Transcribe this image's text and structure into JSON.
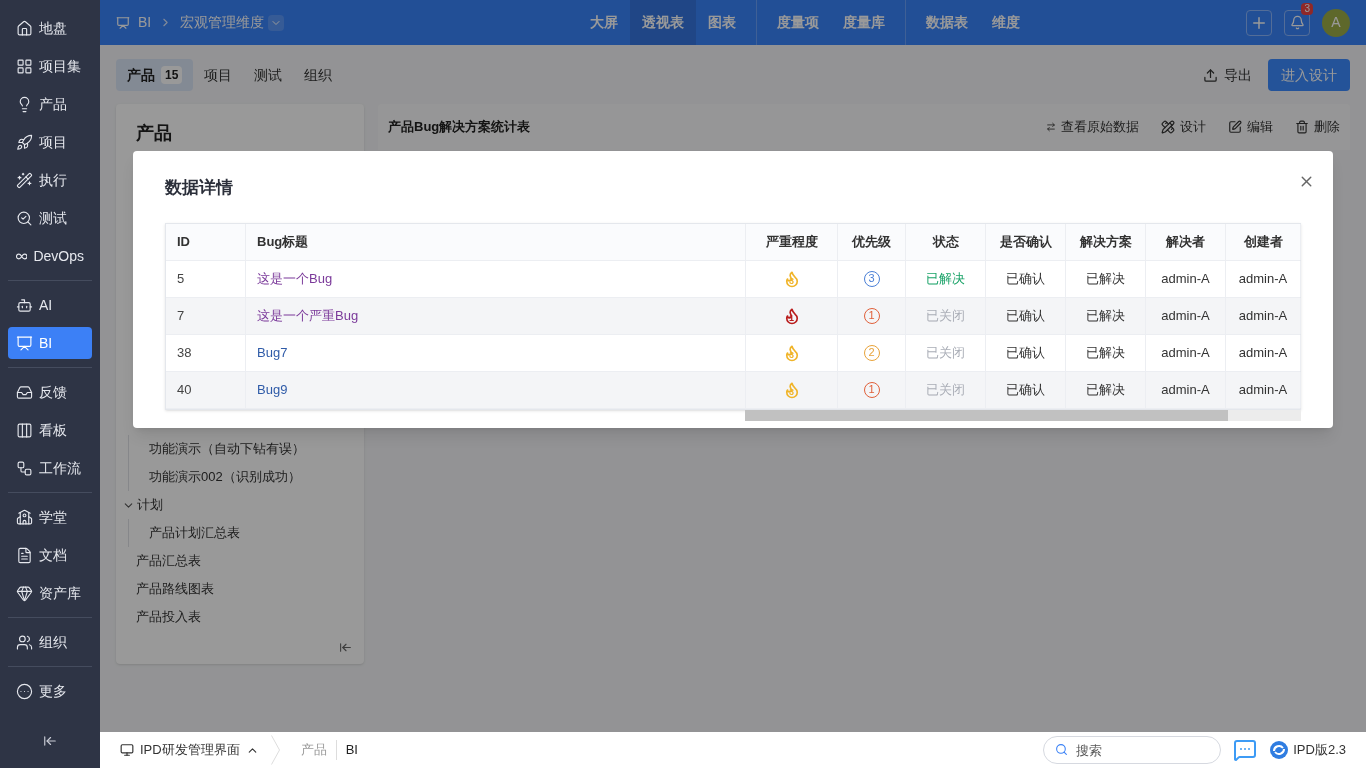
{
  "sidebar": {
    "groups": [
      [
        {
          "label": "地盘",
          "selected": false
        },
        {
          "label": "项目集",
          "selected": false
        },
        {
          "label": "产品",
          "selected": false
        },
        {
          "label": "项目",
          "selected": false
        },
        {
          "label": "执行",
          "selected": false
        },
        {
          "label": "测试",
          "selected": false
        },
        {
          "label": "DevOps",
          "selected": false
        }
      ],
      [
        {
          "label": "AI",
          "selected": false
        },
        {
          "label": "BI",
          "selected": true
        }
      ],
      [
        {
          "label": "反馈",
          "selected": false
        },
        {
          "label": "看板",
          "selected": false
        },
        {
          "label": "工作流",
          "selected": false
        }
      ],
      [
        {
          "label": "学堂",
          "selected": false
        },
        {
          "label": "文档",
          "selected": false
        },
        {
          "label": "资产库",
          "selected": false
        }
      ],
      [
        {
          "label": "组织",
          "selected": false
        }
      ],
      [
        {
          "label": "更多",
          "selected": false
        }
      ]
    ]
  },
  "topbar": {
    "breadcrumb": [
      "BI",
      "宏观管理维度"
    ],
    "nav_groups": [
      [
        {
          "label": "大屏",
          "selected": false
        },
        {
          "label": "透视表",
          "selected": true
        },
        {
          "label": "图表",
          "selected": false
        }
      ],
      [
        {
          "label": "度量项",
          "selected": false
        },
        {
          "label": "度量库",
          "selected": false
        }
      ],
      [
        {
          "label": "数据表",
          "selected": false
        },
        {
          "label": "维度",
          "selected": false
        }
      ]
    ],
    "notification_count": "3",
    "avatar": "A"
  },
  "subtabs": [
    {
      "label": "产品",
      "count": "15",
      "selected": true
    },
    {
      "label": "项目",
      "selected": false
    },
    {
      "label": "测试",
      "selected": false
    },
    {
      "label": "组织",
      "selected": false
    }
  ],
  "actions": {
    "export": "导出",
    "design": "进入设计"
  },
  "left_panel": {
    "title": "产品",
    "tree": [
      {
        "expanded": true,
        "children": [
          {
            "label": "功能演示（自动下钻有误）"
          },
          {
            "label": "功能演示002（识别成功）"
          }
        ]
      },
      {
        "label": "计划",
        "expanded": true,
        "children": [
          {
            "label": "产品计划汇总表"
          }
        ]
      },
      {
        "label": "产品汇总表"
      },
      {
        "label": "产品路线图表"
      },
      {
        "label": "产品投入表"
      }
    ]
  },
  "report": {
    "title": "产品Bug解决方案统计表",
    "actions": [
      "查看原始数据",
      "设计",
      "编辑",
      "删除"
    ]
  },
  "modal": {
    "title": "数据详情",
    "columns": [
      "ID",
      "Bug标题",
      "严重程度",
      "优先级",
      "状态",
      "是否确认",
      "解决方案",
      "解决者",
      "创建者"
    ],
    "rows": [
      {
        "id": "5",
        "title": "这是一个Bug",
        "visited": true,
        "severity": {
          "value": "3",
          "color": "#f0b429"
        },
        "priority": {
          "value": "3",
          "color": "#4a7fd6"
        },
        "status": {
          "text": "已解决",
          "closed": false
        },
        "confirmed": "已确认",
        "resolution": "已解决",
        "resolved_by": "admin-A",
        "created_by": "admin-A"
      },
      {
        "id": "7",
        "title": "这是一个严重Bug",
        "visited": true,
        "severity": {
          "value": "1",
          "color": "#b91c1c"
        },
        "priority": {
          "value": "1",
          "color": "#e0603a"
        },
        "status": {
          "text": "已关闭",
          "closed": true
        },
        "confirmed": "已确认",
        "resolution": "已解决",
        "resolved_by": "admin-A",
        "created_by": "admin-A"
      },
      {
        "id": "38",
        "title": "Bug7",
        "visited": false,
        "severity": {
          "value": "3",
          "color": "#f0b429"
        },
        "priority": {
          "value": "2",
          "color": "#e8a33a"
        },
        "status": {
          "text": "已关闭",
          "closed": true
        },
        "confirmed": "已确认",
        "resolution": "已解决",
        "resolved_by": "admin-A",
        "created_by": "admin-A"
      },
      {
        "id": "40",
        "title": "Bug9",
        "visited": false,
        "severity": {
          "value": "3",
          "color": "#f0b429"
        },
        "priority": {
          "value": "1",
          "color": "#e0603a"
        },
        "status": {
          "text": "已关闭",
          "closed": true
        },
        "confirmed": "已确认",
        "resolution": "已解决",
        "resolved_by": "admin-A",
        "created_by": "admin-A"
      }
    ]
  },
  "bottombar": {
    "app": "IPD研发管理界面",
    "crumbs": [
      "产品",
      "BI"
    ],
    "search_placeholder": "搜索",
    "version": "IPD版2.3"
  }
}
